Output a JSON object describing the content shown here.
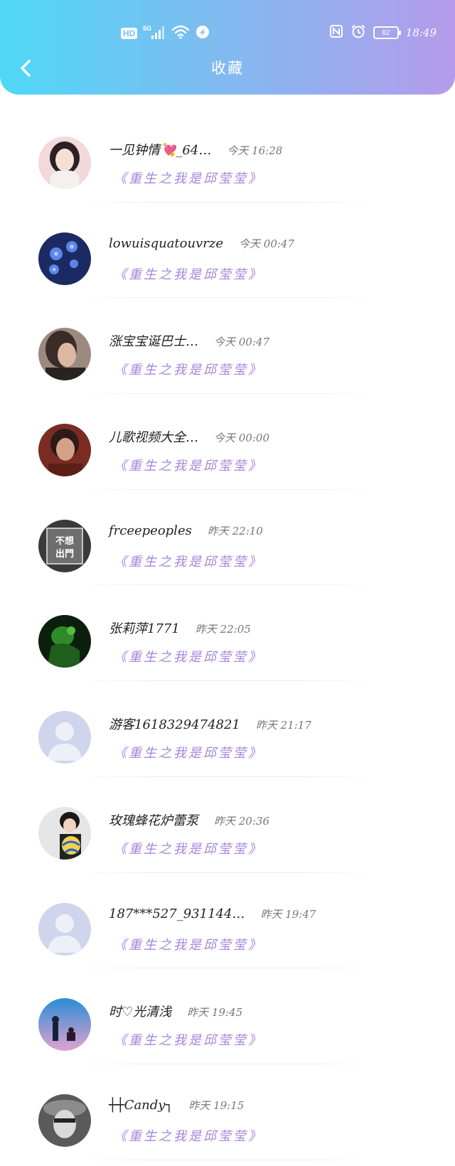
{
  "colors": {
    "header_gradient_start": "#4fd8f6",
    "header_gradient_end": "#b59bea",
    "title_accent": "#a585dc"
  },
  "status_bar": {
    "hd": "HD",
    "network": "5G",
    "battery": "82",
    "time": "18:49"
  },
  "nav": {
    "back_icon": "chevron-left-icon",
    "title": "收藏"
  },
  "items": [
    {
      "name": "一见钟情💘_64…",
      "time": "今天  16:28",
      "title": "《重生之我是邱莹莹》",
      "avatar": "photo-girl-light"
    },
    {
      "name": "lowuisquatouvrze",
      "time": "今天  00:47",
      "title": "《重生之我是邱莹莹》",
      "avatar": "blue-flowers"
    },
    {
      "name": "涨宝宝诞巴士…",
      "time": "今天  00:47",
      "title": "《重生之我是邱莹莹》",
      "avatar": "photo-woman-dark"
    },
    {
      "name": "儿歌视频大全…",
      "time": "今天  00:00",
      "title": "《重生之我是邱莹莹》",
      "avatar": "photo-woman-red"
    },
    {
      "name": "frceepeoples",
      "time": "昨天  22:10",
      "title": "《重生之我是邱莹莹》",
      "avatar": "text-badge",
      "avatar_text": "不想出門"
    },
    {
      "name": "张莉萍1771",
      "time": "昨天  22:05",
      "title": "《重生之我是邱莹莹》",
      "avatar": "green-figure"
    },
    {
      "name": "游客1618329474821",
      "time": "昨天  21:17",
      "title": "《重生之我是邱莹莹》",
      "avatar": "default"
    },
    {
      "name": "玫瑰蜂花炉蕾泵",
      "time": "昨天  20:36",
      "title": "《重生之我是邱莹莹》",
      "avatar": "volleyball-child"
    },
    {
      "name": "187***527_931144…",
      "time": "昨天  19:47",
      "title": "《重生之我是邱莹莹》",
      "avatar": "default"
    },
    {
      "name": "时♡光清浅",
      "time": "昨天  19:45",
      "title": "《重生之我是邱莹莹》",
      "avatar": "night-sky-figure"
    },
    {
      "name": "┼┼Candy┐",
      "time": "昨天  19:15",
      "title": "《重生之我是邱莹莹》",
      "avatar": "bw-hat-person"
    }
  ]
}
